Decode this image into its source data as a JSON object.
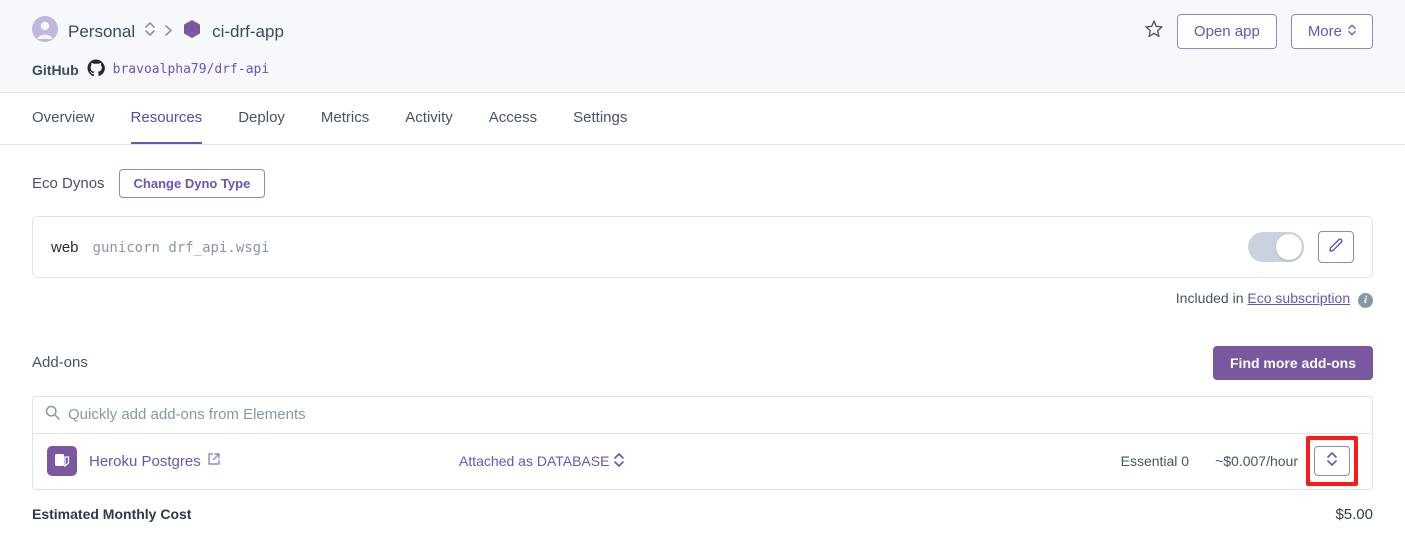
{
  "breadcrumb": {
    "account": "Personal",
    "app": "ci-drf-app"
  },
  "header_buttons": {
    "open_app": "Open app",
    "more": "More"
  },
  "github": {
    "label": "GitHub",
    "repo": "bravoalpha79/drf-api"
  },
  "tabs": [
    "Overview",
    "Resources",
    "Deploy",
    "Metrics",
    "Activity",
    "Access",
    "Settings"
  ],
  "active_tab": "Resources",
  "dynos": {
    "section_label": "Eco Dynos",
    "change_btn": "Change Dyno Type",
    "process_type": "web",
    "command": "gunicorn drf_api.wsgi",
    "included_text": "Included in ",
    "eco_link": "Eco subscription"
  },
  "addons": {
    "section_label": "Add-ons",
    "find_more_btn": "Find more add-ons",
    "search_placeholder": "Quickly add add-ons from Elements",
    "items": [
      {
        "name": "Heroku Postgres",
        "attached_as": "Attached as DATABASE",
        "plan": "Essential 0",
        "price": "~$0.007/hour"
      }
    ]
  },
  "cost": {
    "label": "Estimated Monthly Cost",
    "value": "$5.00"
  }
}
